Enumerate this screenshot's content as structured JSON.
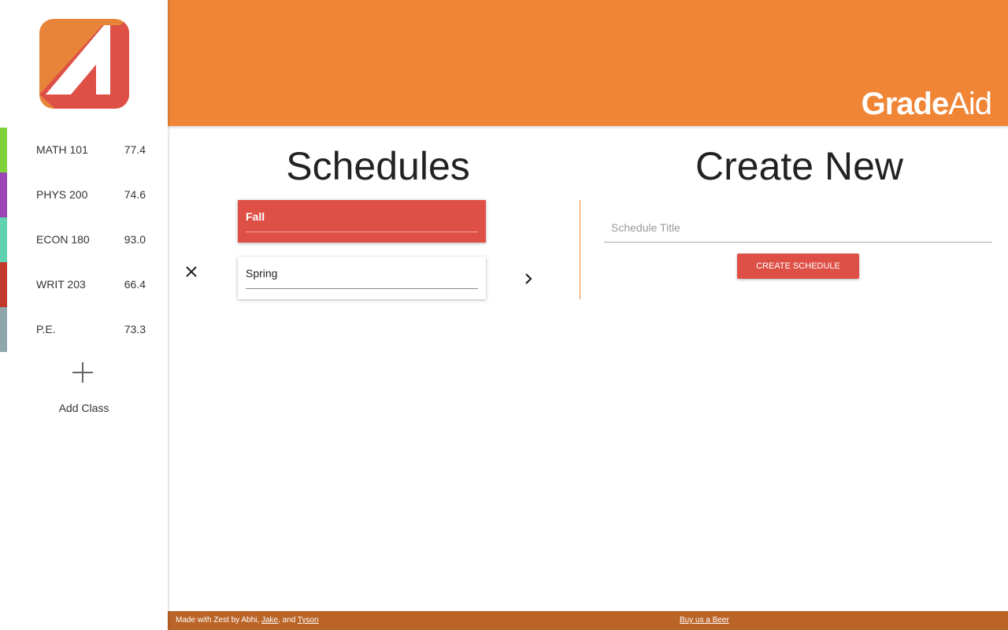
{
  "app": {
    "brand_bold": "Grade",
    "brand_light": "Aid"
  },
  "colors": {
    "header": "#ef8535",
    "footer": "#bb6428",
    "accent_red": "#de5046",
    "logo_orange": "#e8843a"
  },
  "sidebar": {
    "classes": [
      {
        "name": "MATH 101",
        "grade": "77.4",
        "color": "#7ed33a"
      },
      {
        "name": "PHYS 200",
        "grade": "74.6",
        "color": "#9b45b6"
      },
      {
        "name": "ECON 180",
        "grade": "93.0",
        "color": "#5fd2b0"
      },
      {
        "name": "WRIT 203",
        "grade": "66.4",
        "color": "#c0392b"
      },
      {
        "name": "P.E.",
        "grade": "73.3",
        "color": "#8fa6ab"
      }
    ],
    "add_class_label": "Add Class"
  },
  "schedules": {
    "title": "Schedules",
    "items": [
      {
        "name": "Fall",
        "active": true
      },
      {
        "name": "Spring",
        "active": false
      }
    ]
  },
  "create": {
    "title": "Create New",
    "placeholder": "Schedule Title",
    "button_label": "CREATE SCHEDULE"
  },
  "footer": {
    "prefix": "Made with Zest by Abhi, ",
    "link1": "Jake",
    "sep": ", and ",
    "link2": "Tyson",
    "beer": "Buy us a Beer"
  }
}
